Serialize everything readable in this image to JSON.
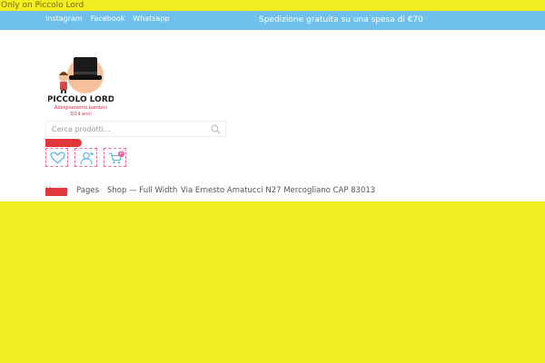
{
  "promo": {
    "text": "Only on Piccolo Lord"
  },
  "topbar": {
    "social": [
      "Instagram",
      "Facebook",
      "Whatsapp"
    ],
    "shipping": "Spedizione gratuita su una spesa di €70"
  },
  "logo": {
    "name": "PICCOLO LORD",
    "tagline": "Abbigliamento bambini",
    "age": "0/14 anni"
  },
  "search": {
    "placeholder": "Cerca prodotti..."
  },
  "icons": {
    "wishlist": "heart-icon",
    "account": "user-add-icon",
    "cart": "cart-icon",
    "cart_count": "0"
  },
  "nav": {
    "items": [
      {
        "label": "Home"
      },
      {
        "label": "Pages"
      },
      {
        "label": "Shop — Full Width"
      },
      {
        "label": "Via Ernesto Amatucci N27 Mercogliano CAP 83013"
      }
    ]
  },
  "colors": {
    "page_bg": "#f0ee20",
    "topbar": "#6fc1ec",
    "accent_red": "#e0373a",
    "accent_pink": "#f06a95"
  }
}
